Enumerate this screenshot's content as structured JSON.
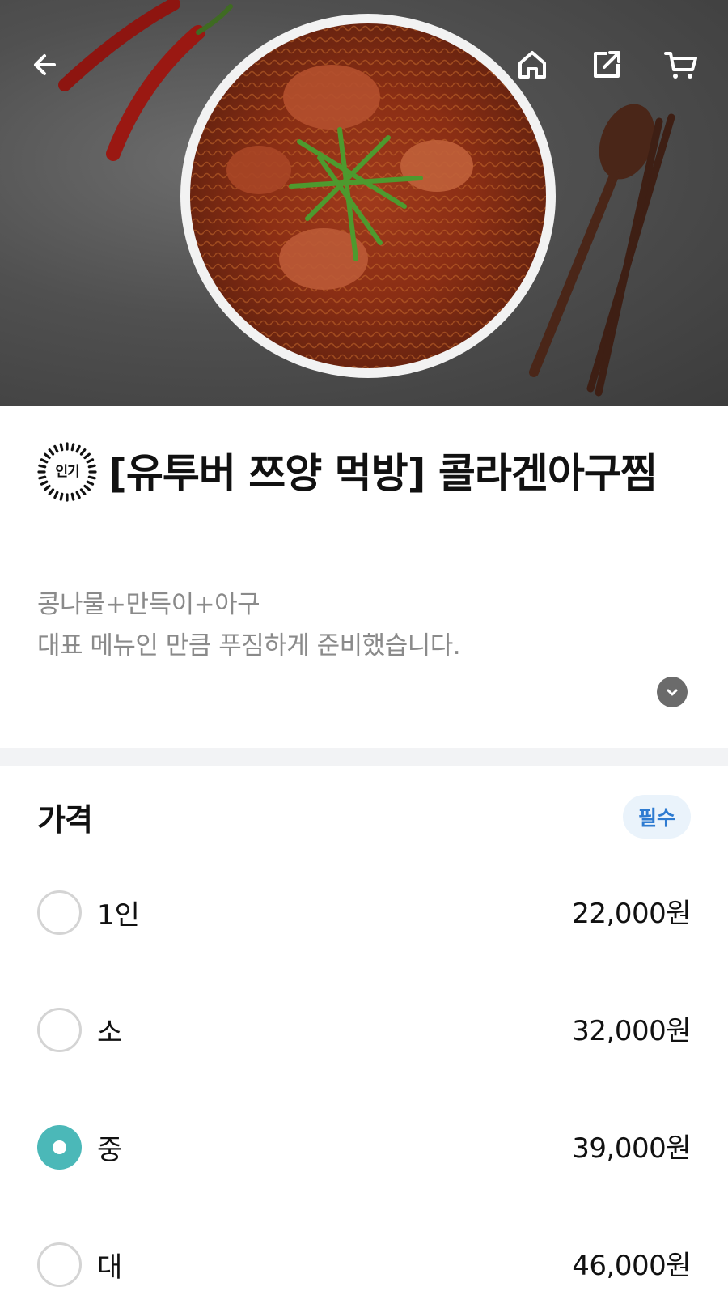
{
  "topbar": {
    "back_icon": "back-arrow-icon",
    "home_icon": "home-icon",
    "share_icon": "share-icon",
    "cart_icon": "cart-icon"
  },
  "menu": {
    "badge": "인기",
    "title": "[유투버 쯔양 먹방] 콜라겐아구찜",
    "description_lines": [
      "콩나물+만득이+아구",
      "대표 메뉴인 만큼 푸짐하게 준비했습니다."
    ]
  },
  "price_section": {
    "title": "가격",
    "required_label": "필수",
    "options": [
      {
        "label": "1인",
        "price": "22,000원",
        "selected": false
      },
      {
        "label": "소",
        "price": "32,000원",
        "selected": false
      },
      {
        "label": "중",
        "price": "39,000원",
        "selected": true
      },
      {
        "label": "대",
        "price": "46,000원",
        "selected": false
      }
    ]
  },
  "colors": {
    "accent": "#4bb8b8",
    "required_badge_bg": "#eaf3fb",
    "required_badge_text": "#2e7bd1",
    "description_text": "#8a8a8a",
    "divider": "#f2f3f5"
  }
}
